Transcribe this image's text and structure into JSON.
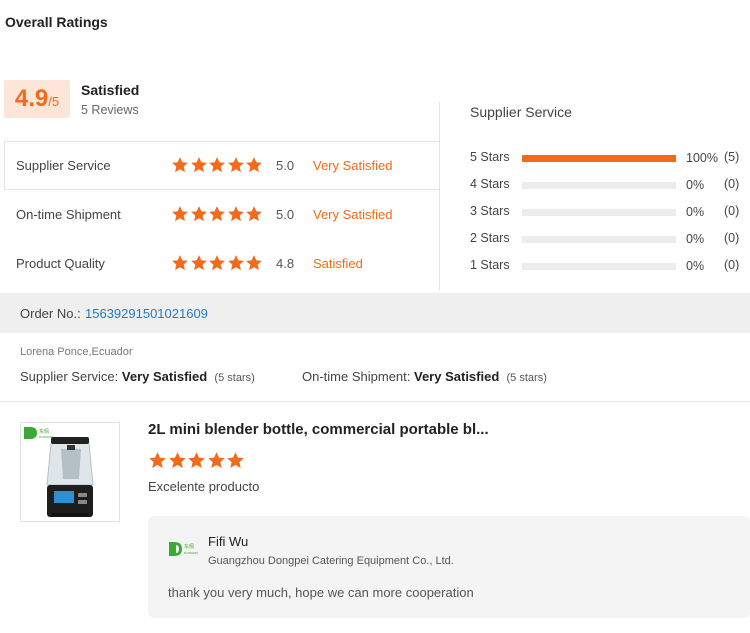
{
  "page": {
    "title": "Overall Ratings"
  },
  "summary": {
    "score": "4.9",
    "score_suffix": "/5",
    "sentiment": "Satisfied",
    "review_count": "5 Reviews",
    "accent_color": "#f26a1b"
  },
  "ratings": [
    {
      "label": "Supplier Service",
      "stars": 5,
      "score": "5.0",
      "sentiment": "Very Satisfied"
    },
    {
      "label": "On-time Shipment",
      "stars": 5,
      "score": "5.0",
      "sentiment": "Very Satisfied"
    },
    {
      "label": "Product Quality",
      "stars": 5,
      "score": "4.8",
      "sentiment": "Satisfied"
    }
  ],
  "distribution": {
    "title": "Supplier Service",
    "rows": [
      {
        "label": "5 Stars",
        "fraction": 1.0,
        "percent": "100%",
        "count": "(5)"
      },
      {
        "label": "4 Stars",
        "fraction": 0,
        "percent": "0%",
        "count": "(0)"
      },
      {
        "label": "3 Stars",
        "fraction": 0,
        "percent": "0%",
        "count": "(0)"
      },
      {
        "label": "2 Stars",
        "fraction": 0,
        "percent": "0%",
        "count": "(0)"
      },
      {
        "label": "1 Stars",
        "fraction": 0,
        "percent": "0%",
        "count": "(0)"
      }
    ]
  },
  "order": {
    "label": "Order No.:",
    "number": "15639291501021609"
  },
  "review": {
    "reviewer": "Lorena Ponce,Ecuador",
    "supplier_label": "Supplier Service:",
    "supplier_value": "Very Satisfied",
    "supplier_stars": "(5 stars)",
    "shipment_label": "On-time Shipment:",
    "shipment_value": "Very Satisfied",
    "shipment_stars": "(5 stars)",
    "product_title": "2L mini blender bottle, commercial portable bl...",
    "product_stars": 5,
    "comment": "Excelente producto",
    "product_image_icon": "blender-product-image"
  },
  "reply": {
    "name": "Fifi Wu",
    "company": "Guangzhou Dongpei Catering Equipment Co., Ltd.",
    "text": "thank you very much, hope we can more cooperation",
    "logo_icon": "company-logo-icon"
  }
}
